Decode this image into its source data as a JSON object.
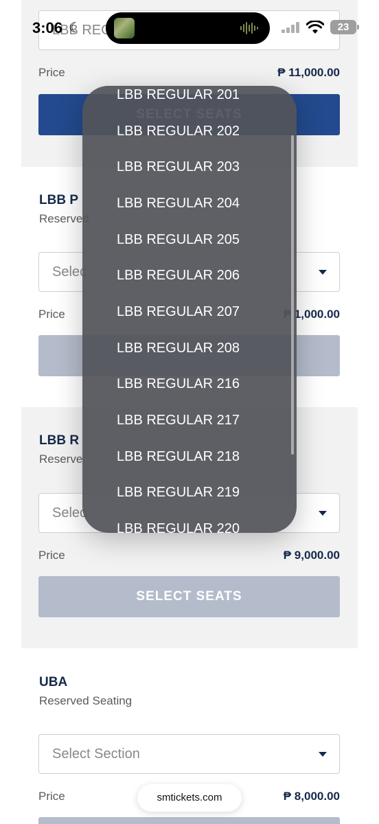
{
  "status_bar": {
    "time": "3:06",
    "moon": "☾",
    "battery": "23"
  },
  "sections": [
    {
      "select_text": "LBB REG",
      "price_label": "Price",
      "price": "₱ 11,000.00",
      "button": "SELECT SEATS"
    },
    {
      "title": "LBB P",
      "subtitle": "Reserved",
      "select_text": "Selec",
      "price_label": "Price",
      "price": "₱ 1,000.00"
    },
    {
      "title": "LBB R",
      "subtitle": "Reserve",
      "select_text": "Selec",
      "price_label": "Price",
      "price": "₱ 9,000.00",
      "button": "SELECT SEATS"
    },
    {
      "title": "UBA",
      "subtitle": "Reserved Seating",
      "select_text": "Select Section",
      "price_label": "Price",
      "price": "₱ 8,000.00"
    }
  ],
  "dropdown": {
    "options": [
      "LBB REGULAR 201",
      "LBB REGULAR 202",
      "LBB REGULAR 203",
      "LBB REGULAR 204",
      "LBB REGULAR 205",
      "LBB REGULAR 206",
      "LBB REGULAR 207",
      "LBB REGULAR 208",
      "LBB REGULAR 216",
      "LBB REGULAR 217",
      "LBB REGULAR 218",
      "LBB REGULAR 219",
      "LBB REGULAR 220"
    ]
  },
  "browser": {
    "url": "smtickets.com"
  },
  "colors": {
    "navy": "#15294b",
    "primary_button": "#234a8e",
    "disabled_button": "#b4bccb",
    "section_gray": "#f2f2f2"
  },
  "icons": [
    "moon-icon",
    "signal-icon",
    "wifi-icon",
    "battery-icon",
    "caret-down-icon"
  ]
}
